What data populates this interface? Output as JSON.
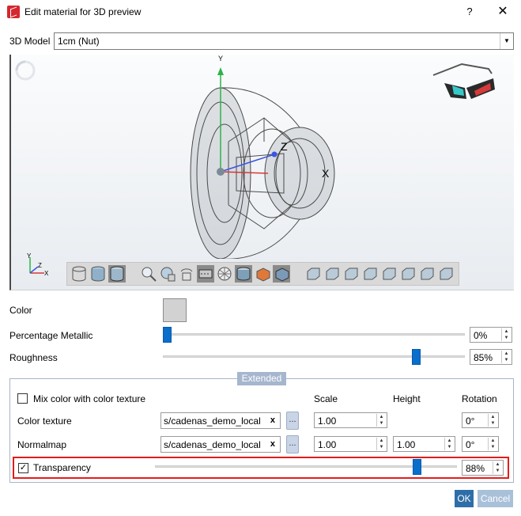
{
  "window": {
    "title": "Edit material for 3D preview",
    "help": "?",
    "close": "✕"
  },
  "model": {
    "label": "3D Model",
    "value": "1cm (Nut)"
  },
  "viewport": {
    "axis_y": "Y",
    "axis_z": "Z",
    "axis_x": "X",
    "triad_y": "Y",
    "triad_z": "Z",
    "triad_x": "X"
  },
  "properties": {
    "color_label": "Color",
    "color_value": "#d2d2d2",
    "metallic_label": "Percentage Metallic",
    "metallic_value": "0%",
    "metallic_level": 0.0,
    "roughness_label": "Roughness",
    "roughness_value": "85%",
    "roughness_level": 0.85
  },
  "extended": {
    "tab_label": "Extended",
    "mix_label": "Mix color with color texture",
    "mix_checked": false,
    "col_scale": "Scale",
    "col_height": "Height",
    "col_rotation": "Rotation",
    "color_texture": {
      "label": "Color texture",
      "path": "s/cadenas_demo_local",
      "clear": "x",
      "browse": "...",
      "scale": "1.00",
      "rotation": "0°"
    },
    "normalmap": {
      "label": "Normalmap",
      "path": "s/cadenas_demo_local",
      "clear": "x",
      "browse": "...",
      "scale": "1.00",
      "height": "1.00",
      "rotation": "0°"
    },
    "transparency": {
      "label": "Transparency",
      "checked": true,
      "value": "88%",
      "level": 0.88,
      "check": "✓"
    }
  },
  "buttons": {
    "ok": "OK",
    "cancel": "Cancel"
  },
  "colors": {
    "accent": "#0a6ecb",
    "highlight": "#e41c1c",
    "ok_button": "#2e6ea8",
    "cancel_button": "#a9c0d9"
  }
}
